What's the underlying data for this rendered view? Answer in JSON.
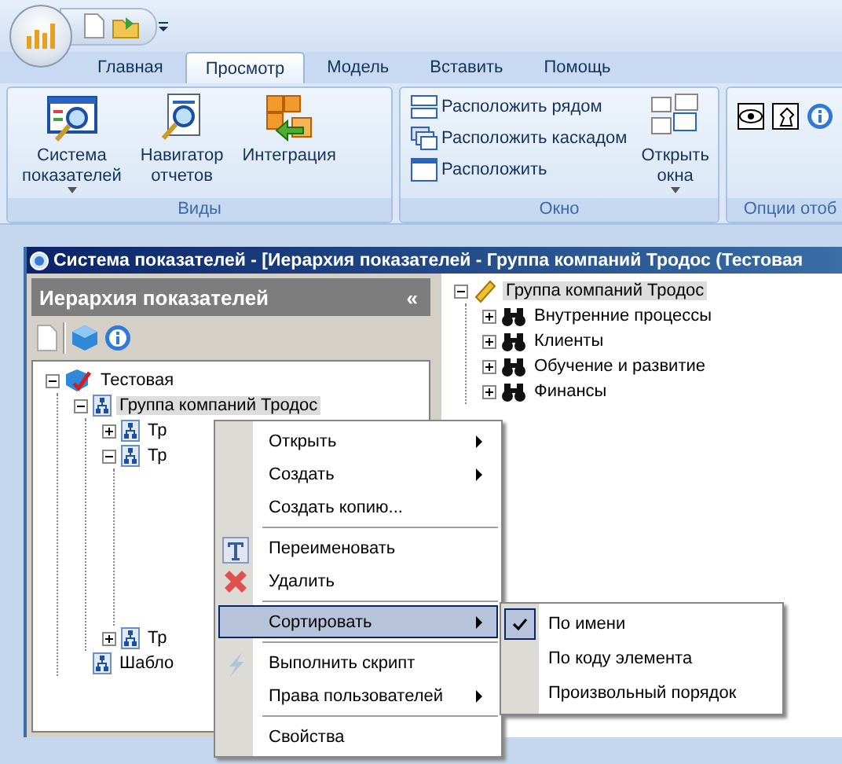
{
  "tabs": [
    {
      "label": "Главная",
      "selected": false
    },
    {
      "label": "Просмотр",
      "selected": true
    },
    {
      "label": "Модель",
      "selected": false
    },
    {
      "label": "Вставить",
      "selected": false
    },
    {
      "label": "Помощь",
      "selected": false
    }
  ],
  "ribbon_groups": [
    {
      "label": "Виды",
      "items": [
        {
          "kind": "large",
          "label": "Система\nпоказателей",
          "dropdown": true
        },
        {
          "kind": "large",
          "label": "Навигатор\nотчетов",
          "dropdown": false
        },
        {
          "kind": "large",
          "label": "Интеграция",
          "dropdown": false
        }
      ]
    },
    {
      "label": "Окно",
      "items": [
        {
          "kind": "small",
          "label": "Расположить рядом"
        },
        {
          "kind": "small",
          "label": "Расположить каскадом"
        },
        {
          "kind": "small",
          "label": "Расположить"
        },
        {
          "kind": "large",
          "label": "Открыть\nокна",
          "dropdown": true
        }
      ]
    },
    {
      "label": "Опции отоб",
      "items": [
        {
          "kind": "icon"
        },
        {
          "kind": "icon"
        },
        {
          "kind": "icon"
        }
      ]
    }
  ],
  "window": {
    "title": "Система показателей - [Иерархия показателей - Группа компаний Тродос (Тестовая"
  },
  "left_panel": {
    "title": "Иерархия показателей",
    "collapse": "«",
    "tree": [
      {
        "label": "Тестовая",
        "expanded": true,
        "selected": false,
        "children": [
          {
            "label": "Группа компаний Тродос",
            "expanded": true,
            "selected": true,
            "children": [
              {
                "label": "Тр",
                "expanded": false,
                "selected": false
              },
              {
                "label": "Тр",
                "expanded": true,
                "selected": false
              },
              {
                "label": "Тр",
                "expanded": false,
                "selected": false
              }
            ]
          },
          {
            "label": "Шабло",
            "selected": false
          }
        ]
      }
    ]
  },
  "right_tree": [
    {
      "label": "Группа компаний Тродос",
      "expanded": true,
      "selected": true,
      "children": [
        {
          "label": "Внутренние процессы",
          "expanded": false,
          "selected": false
        },
        {
          "label": "Клиенты",
          "expanded": false,
          "selected": false
        },
        {
          "label": "Обучение и развитие",
          "expanded": false,
          "selected": false
        },
        {
          "label": "Финансы",
          "expanded": false,
          "selected": false
        }
      ]
    }
  ],
  "context_menu": [
    {
      "kind": "item",
      "label": "Открыть",
      "submenu": true,
      "selected": false
    },
    {
      "kind": "item",
      "label": "Создать",
      "submenu": true,
      "selected": false
    },
    {
      "kind": "item",
      "label": "Создать копию...",
      "submenu": false,
      "selected": false
    },
    {
      "kind": "separator"
    },
    {
      "kind": "item",
      "label": "Переименовать",
      "submenu": false,
      "selected": false
    },
    {
      "kind": "item",
      "label": "Удалить",
      "submenu": false,
      "selected": false
    },
    {
      "kind": "separator"
    },
    {
      "kind": "item",
      "label": "Сортировать",
      "submenu": true,
      "selected": true
    },
    {
      "kind": "separator"
    },
    {
      "kind": "item",
      "label": "Выполнить скрипт",
      "submenu": false,
      "selected": false
    },
    {
      "kind": "item",
      "label": "Права пользователей",
      "submenu": true,
      "selected": false
    },
    {
      "kind": "separator"
    },
    {
      "kind": "item",
      "label": "Свойства",
      "submenu": false,
      "selected": false
    }
  ],
  "submenu": [
    {
      "label": "По имени",
      "checked": true
    },
    {
      "label": "По коду элемента",
      "checked": false
    },
    {
      "label": "Произвольный порядок",
      "checked": false
    }
  ]
}
